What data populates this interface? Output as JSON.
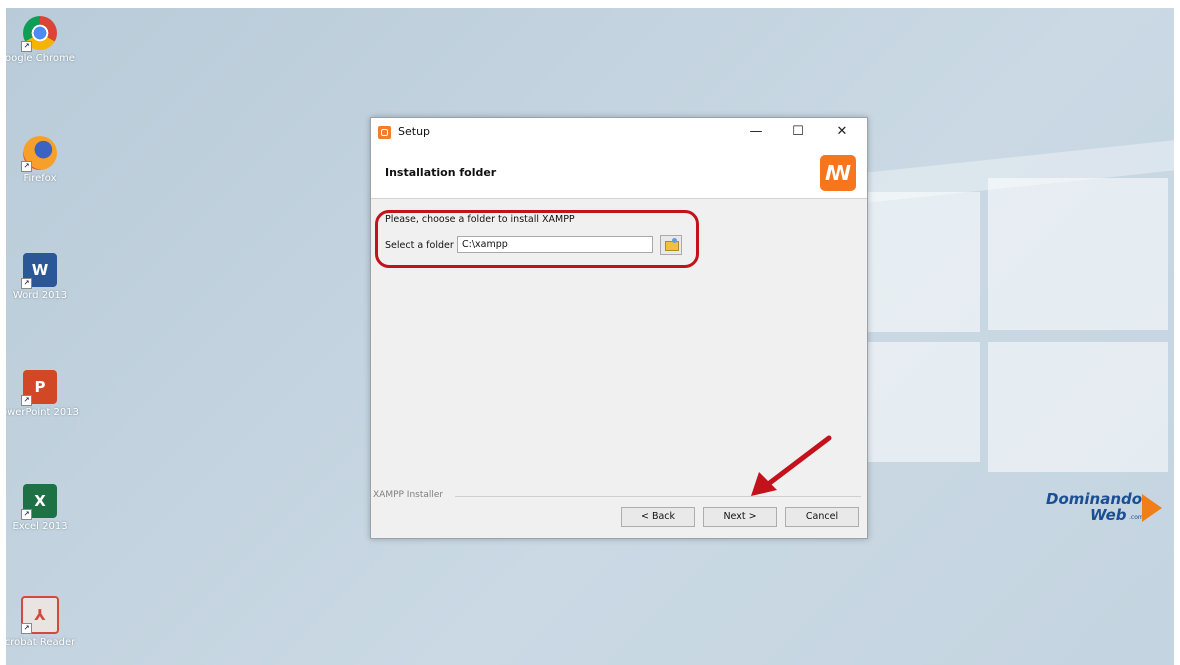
{
  "desktop": {
    "icons": [
      {
        "label": "oogle Chrome",
        "icon": "chrome-icon"
      },
      {
        "label": "Firefox",
        "icon": "firefox-icon"
      },
      {
        "label": "Word 2013",
        "icon": "word-icon",
        "letter": "W"
      },
      {
        "label": "owerPoint 2013",
        "icon": "powerpoint-icon",
        "letter": "P"
      },
      {
        "label": "Excel 2013",
        "icon": "excel-icon",
        "letter": "X"
      },
      {
        "label": "crobat Reader",
        "icon": "acrobat-icon"
      }
    ]
  },
  "window": {
    "title": "Setup",
    "controls": {
      "minimize": "—",
      "maximize": "☐",
      "close": "✕"
    },
    "header": {
      "title": "Installation folder",
      "logo": "ꟿ"
    },
    "prompt": "Please, choose a folder to install XAMPP",
    "folder_label": "Select a folder",
    "folder_value": "C:\\xampp",
    "footer_label": "XAMPP Installer",
    "buttons": {
      "back": "< Back",
      "next": "Next >",
      "cancel": "Cancel"
    }
  },
  "watermark": {
    "line1": "Dominando",
    "line2": "Web",
    "suffix": ".com"
  },
  "colors": {
    "highlight": "#c3121b",
    "arrow": "#c3121b",
    "xampp_orange": "#f5761e",
    "brand_blue": "#1b4f93"
  }
}
